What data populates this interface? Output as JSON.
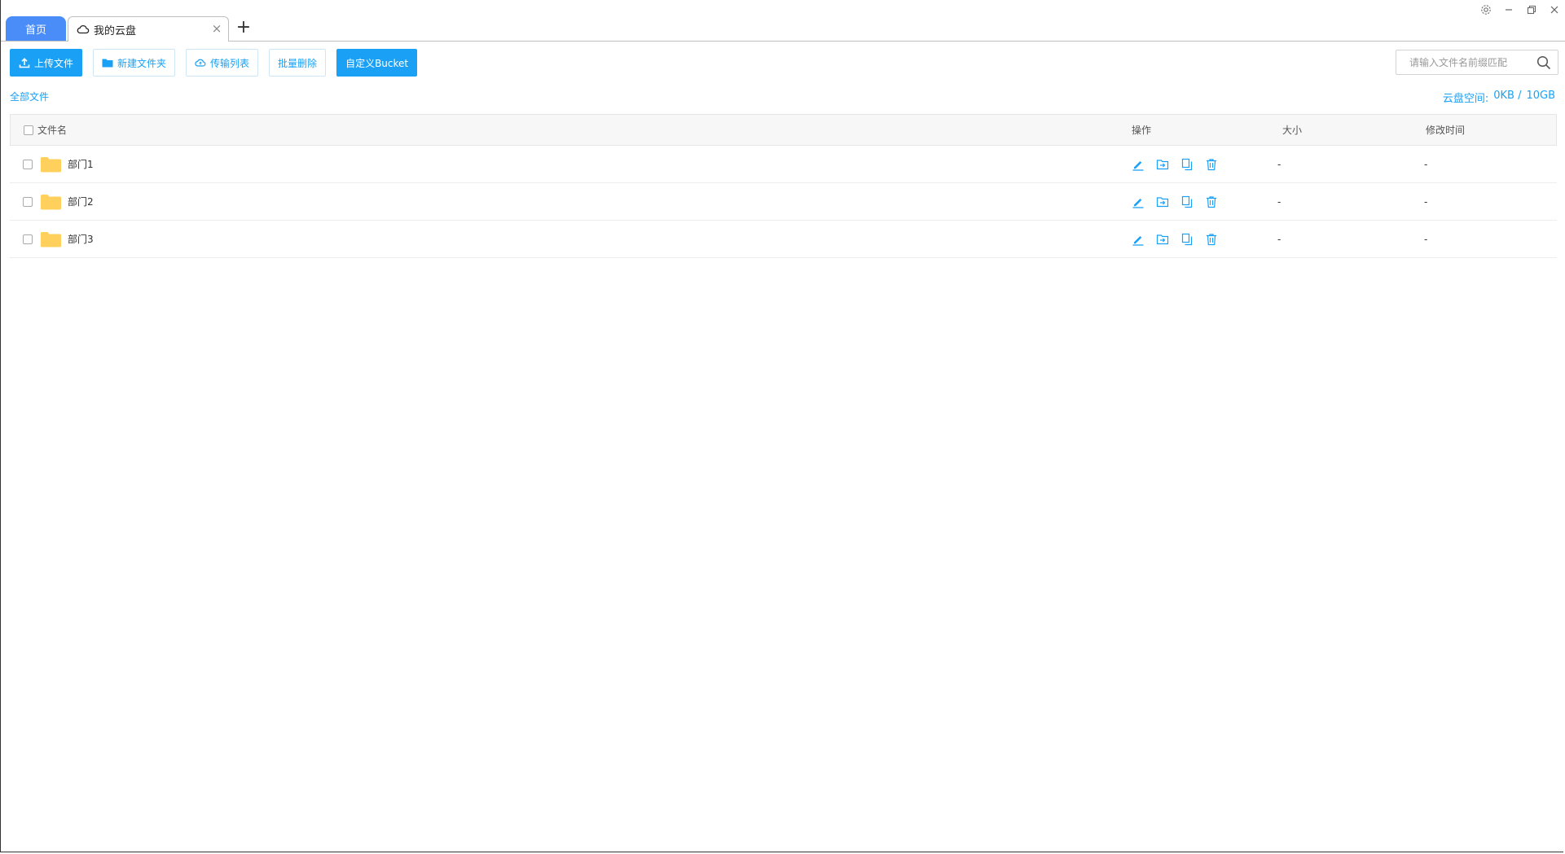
{
  "tabs": {
    "home_label": "首页",
    "active_label": "我的云盘",
    "close_glyph": "×",
    "add_glyph": "+"
  },
  "toolbar": {
    "upload_label": "上传文件",
    "new_folder_label": "新建文件夹",
    "transfer_list_label": "传输列表",
    "batch_delete_label": "批量删除",
    "custom_bucket_label": "自定义Bucket"
  },
  "search": {
    "placeholder": "请输入文件名前缀匹配",
    "value": ""
  },
  "breadcrumb": {
    "label": "全部文件"
  },
  "quota": {
    "label": "云盘空间:",
    "used": "0KB /",
    "total": "10GB"
  },
  "table": {
    "columns": {
      "name": "文件名",
      "ops": "操作",
      "size": "大小",
      "modified": "修改时间"
    },
    "rows": [
      {
        "name": "部门1",
        "size": "-",
        "modified": "-"
      },
      {
        "name": "部门2",
        "size": "-",
        "modified": "-"
      },
      {
        "name": "部门3",
        "size": "-",
        "modified": "-"
      }
    ]
  },
  "colors": {
    "accent": "#1aa1f5",
    "tab_home": "#4a8df8",
    "folder": "#ffd15c"
  },
  "icons": {
    "row_ops": [
      "edit-icon",
      "move-icon",
      "copy-icon",
      "delete-icon"
    ],
    "window": [
      "settings-icon",
      "minimize-icon",
      "restore-icon",
      "close-icon"
    ]
  }
}
